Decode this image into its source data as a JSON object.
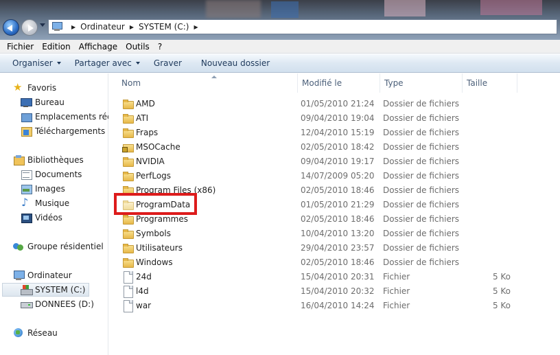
{
  "address": {
    "crumbs": [
      "Ordinateur",
      "SYSTEM (C:)"
    ]
  },
  "menu": [
    "Fichier",
    "Edition",
    "Affichage",
    "Outils",
    "?"
  ],
  "toolbar": {
    "organiser": "Organiser",
    "partager": "Partager avec",
    "graver": "Graver",
    "nouveau_dossier": "Nouveau dossier"
  },
  "nav": {
    "favoris": "Favoris",
    "bureau": "Bureau",
    "emplacements": "Emplacements récents",
    "telechargements": "Téléchargements",
    "bibliotheques": "Bibliothèques",
    "documents": "Documents",
    "images": "Images",
    "musique": "Musique",
    "videos": "Vidéos",
    "groupe": "Groupe résidentiel",
    "ordinateur": "Ordinateur",
    "system": "SYSTEM (C:)",
    "donnees": "DONNEES (D:)",
    "reseau": "Réseau"
  },
  "columns": {
    "name": "Nom",
    "date": "Modifié le",
    "type": "Type",
    "size": "Taille"
  },
  "files": [
    {
      "name": "AMD",
      "date": "01/05/2010 21:24",
      "type": "Dossier de fichiers",
      "size": "",
      "icon": "folder-icon"
    },
    {
      "name": "ATI",
      "date": "09/04/2010 19:04",
      "type": "Dossier de fichiers",
      "size": "",
      "icon": "folder-icon"
    },
    {
      "name": "Fraps",
      "date": "12/04/2010 15:19",
      "type": "Dossier de fichiers",
      "size": "",
      "icon": "folder-icon"
    },
    {
      "name": "MSOCache",
      "date": "02/05/2010 18:42",
      "type": "Dossier de fichiers",
      "size": "",
      "icon": "folder-lock-icon"
    },
    {
      "name": "NVIDIA",
      "date": "09/04/2010 19:17",
      "type": "Dossier de fichiers",
      "size": "",
      "icon": "folder-icon"
    },
    {
      "name": "PerfLogs",
      "date": "14/07/2009 05:20",
      "type": "Dossier de fichiers",
      "size": "",
      "icon": "folder-icon"
    },
    {
      "name": "Program Files (x86)",
      "date": "02/05/2010 18:46",
      "type": "Dossier de fichiers",
      "size": "",
      "icon": "folder-icon"
    },
    {
      "name": "ProgramData",
      "date": "01/05/2010 21:29",
      "type": "Dossier de fichiers",
      "size": "",
      "icon": "folder-light-icon"
    },
    {
      "name": "Programmes",
      "date": "02/05/2010 18:46",
      "type": "Dossier de fichiers",
      "size": "",
      "icon": "folder-icon"
    },
    {
      "name": "Symbols",
      "date": "10/04/2010 13:20",
      "type": "Dossier de fichiers",
      "size": "",
      "icon": "folder-icon"
    },
    {
      "name": "Utilisateurs",
      "date": "29/04/2010 23:57",
      "type": "Dossier de fichiers",
      "size": "",
      "icon": "folder-icon"
    },
    {
      "name": "Windows",
      "date": "02/05/2010 18:46",
      "type": "Dossier de fichiers",
      "size": "",
      "icon": "folder-icon"
    },
    {
      "name": "24d",
      "date": "15/04/2010 20:31",
      "type": "Fichier",
      "size": "5 Ko",
      "icon": "file-icon"
    },
    {
      "name": "l4d",
      "date": "15/04/2010 20:32",
      "type": "Fichier",
      "size": "5 Ko",
      "icon": "file-icon"
    },
    {
      "name": "war",
      "date": "16/04/2010 14:24",
      "type": "Fichier",
      "size": "5 Ko",
      "icon": "file-icon"
    }
  ],
  "colors": {
    "highlight": "#dd1b1b",
    "toolbar_text": "#1e395b",
    "secondary_text": "#6d6d6d"
  }
}
